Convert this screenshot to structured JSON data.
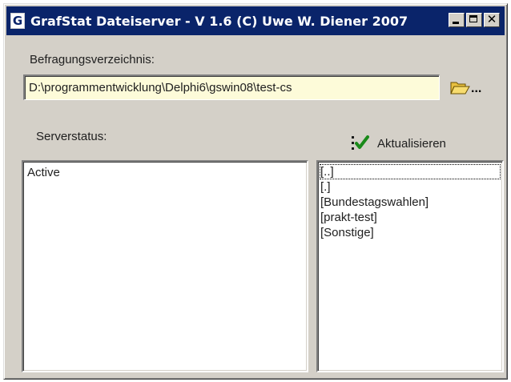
{
  "window": {
    "icon_letter": "G",
    "title": "GrafStat Dateiserver - V 1.6 (C) Uwe W. Diener 2007"
  },
  "directory": {
    "label": "Befragungsverzeichnis:",
    "value": "D:\\programmentwicklung\\Delphi6\\gswin08\\test-cs",
    "browse_label": "..."
  },
  "server": {
    "label": "Serverstatus:",
    "refresh_label": "Aktualisieren",
    "status_lines": [
      "Active"
    ]
  },
  "folders": [
    "[..]",
    "[.]",
    "[Bundestagswahlen]",
    "[prakt-test]",
    "[Sonstige]"
  ],
  "icons": {
    "folder": "folder-open-icon",
    "refresh": "checkmark-refresh-icon"
  },
  "colors": {
    "titlebar": "#0a246a",
    "field_background": "#fdfbd9",
    "window": "#d4d0c8"
  }
}
